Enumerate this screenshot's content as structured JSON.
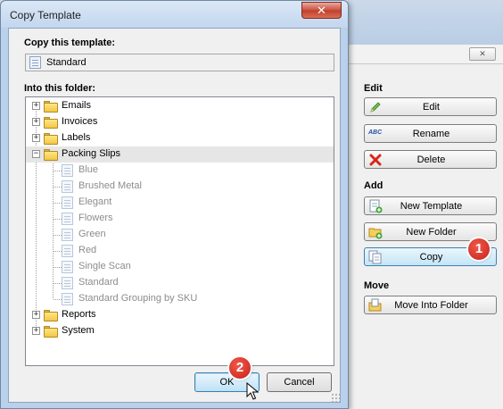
{
  "dialog": {
    "title": "Copy Template",
    "close_glyph": "✕",
    "copy_label": "Copy this template:",
    "template_value": "Standard",
    "folder_label": "Into this folder:",
    "ok_label": "OK",
    "cancel_label": "Cancel"
  },
  "tree": {
    "folders_top": [
      "Emails",
      "Invoices",
      "Labels",
      "Packing Slips"
    ],
    "packing_children": [
      "Blue",
      "Brushed Metal",
      "Elegant",
      "Flowers",
      "Green",
      "Red",
      "Single Scan",
      "Standard",
      "Standard Grouping by SKU"
    ],
    "folders_bottom": [
      "Reports",
      "System"
    ],
    "selected": "Packing Slips"
  },
  "background": {
    "close_glyph": "✕",
    "edit_section": "Edit",
    "edit_label": "Edit",
    "rename_label": "Rename",
    "delete_label": "Delete",
    "add_section": "Add",
    "new_template_label": "New Template",
    "new_folder_label": "New Folder",
    "copy_label": "Copy",
    "move_section": "Move",
    "move_into_folder_label": "Move Into Folder",
    "rename_icon_text": "ABC"
  },
  "callouts": {
    "step1": "1",
    "step2": "2"
  },
  "icons": {
    "close": "close-icon",
    "template": "document-icon",
    "folder": "folder-icon",
    "edit": "pencil-icon",
    "rename": "rename-abc-icon",
    "delete": "red-x-icon",
    "new_template": "new-document-icon",
    "new_folder": "new-folder-icon",
    "copy": "copy-icon",
    "move": "move-icon"
  },
  "colors": {
    "title_bar": "#c2d6ee",
    "close_red": "#c23e2b",
    "badge_red": "#d3261c",
    "selection": "#e6e6e6",
    "hot_button": "#c4e5f6"
  }
}
